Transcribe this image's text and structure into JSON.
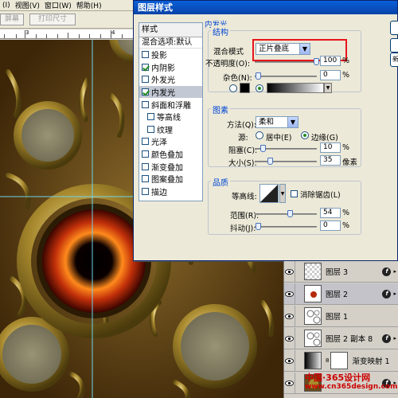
{
  "menubar": {
    "items": [
      "(I)",
      "视图(V)",
      "窗口(W)",
      "帮助(H)"
    ]
  },
  "options_bar": {
    "btn_screen": "屏幕",
    "btn_print_size": "打印尺寸"
  },
  "ruler": {
    "ticks": [
      "3",
      "4"
    ]
  },
  "dialog": {
    "title": "图层样式",
    "style_list": {
      "header": "样式",
      "blend_options": "混合选项:默认",
      "items": [
        {
          "label": "投影",
          "checked": false,
          "sub": false
        },
        {
          "label": "内阴影",
          "checked": true,
          "sub": false
        },
        {
          "label": "外发光",
          "checked": false,
          "sub": false
        },
        {
          "label": "内发光",
          "checked": true,
          "sub": false,
          "selected": true
        },
        {
          "label": "斜面和浮雕",
          "checked": false,
          "sub": false
        },
        {
          "label": "等高线",
          "checked": false,
          "sub": true
        },
        {
          "label": "纹理",
          "checked": false,
          "sub": true
        },
        {
          "label": "光泽",
          "checked": false,
          "sub": false
        },
        {
          "label": "颜色叠加",
          "checked": false,
          "sub": false
        },
        {
          "label": "渐变叠加",
          "checked": false,
          "sub": false
        },
        {
          "label": "图案叠加",
          "checked": false,
          "sub": false
        },
        {
          "label": "描边",
          "checked": false,
          "sub": false
        }
      ]
    },
    "inner_glow": {
      "title": "内发光",
      "structure": {
        "title": "结构",
        "blend_mode_label": "混合模式",
        "blend_mode_value": "正片叠底",
        "opacity_label": "不透明度(O):",
        "opacity_value": "100",
        "noise_label": "杂色(N):",
        "noise_value": "0",
        "percent": "%"
      },
      "elements": {
        "title": "图素",
        "method_label": "方法(Q):",
        "method_value": "柔和",
        "source_label": "源:",
        "source_center": "居中(E)",
        "source_edge": "边缘(G)",
        "choke_label": "阻塞(C):",
        "choke_value": "10",
        "size_label": "大小(S):",
        "size_value": "35",
        "px_unit": "像素"
      },
      "quality": {
        "title": "品质",
        "contour_label": "等高线:",
        "antialias_label": "消除锯齿(L)",
        "range_label": "范围(R):",
        "range_value": "54",
        "jitter_label": "抖动(J):",
        "jitter_value": "0"
      }
    },
    "right_buttons": [
      "",
      "",
      "新"
    ]
  },
  "layers": [
    {
      "name": "图层 3",
      "fx": true,
      "active": false,
      "thumb": "transparent"
    },
    {
      "name": "图层 2",
      "fx": true,
      "active": true,
      "thumb": "red-dot"
    },
    {
      "name": "图层 1",
      "fx": false,
      "active": false,
      "thumb": "pattern"
    },
    {
      "name": "图层 2 副本 8",
      "fx": true,
      "active": false,
      "thumb": "pattern"
    },
    {
      "name": "渐变映射 1",
      "fx": false,
      "active": false,
      "thumb": "gradient"
    },
    {
      "name": "",
      "fx": true,
      "active": false,
      "thumb": "photo"
    }
  ],
  "watermark": {
    "line1": "中国·365设计网",
    "line2": "www.cn365design.com"
  },
  "colors": {
    "highlight_box": "#e8141c",
    "title_bar": "#0a5fd8",
    "group_label": "#0046d5"
  }
}
